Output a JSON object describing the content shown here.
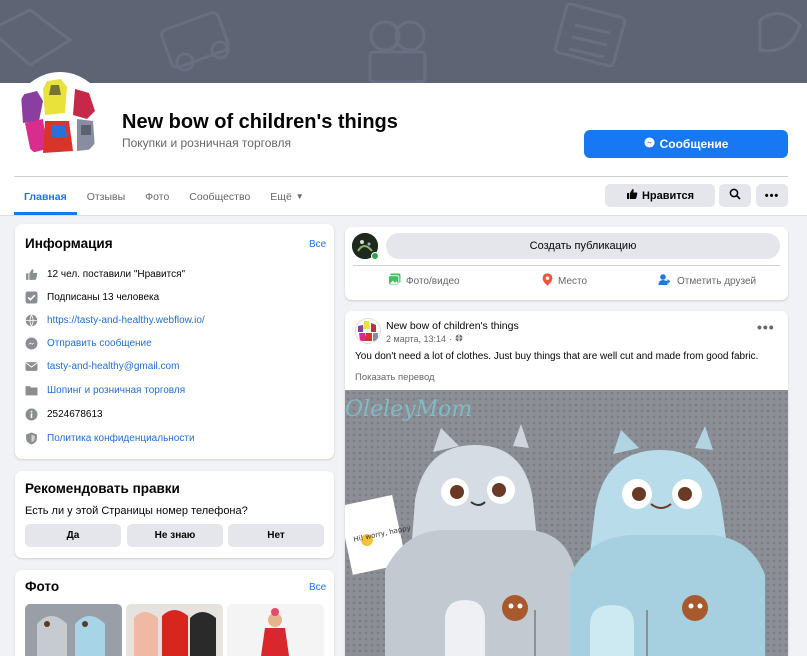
{
  "colors": {
    "accent": "#1877f2",
    "cover": "#5e6474",
    "button_grey": "#e4e6eb",
    "online": "#31a24c"
  },
  "page": {
    "title": "New bow of children's things",
    "category": "Покупки и розничная торговля",
    "message_button": "Сообщение",
    "like_button": "Нравится"
  },
  "tabs": [
    {
      "label": "Главная",
      "active": true
    },
    {
      "label": "Отзывы"
    },
    {
      "label": "Фото"
    },
    {
      "label": "Сообщество"
    },
    {
      "label": "Ещё"
    }
  ],
  "info": {
    "title": "Информация",
    "see_all": "Все",
    "rows": [
      {
        "icon": "thumbs-up-icon",
        "text": "12 чел. поставили \"Нравится\""
      },
      {
        "icon": "check-square-icon",
        "text": "Подписаны 13 человека"
      },
      {
        "icon": "globe-icon",
        "text": "https://tasty-and-healthy.webflow.io/"
      },
      {
        "icon": "messenger-icon",
        "text": "Отправить сообщение"
      },
      {
        "icon": "envelope-icon",
        "text": "tasty-and-healthy@gmail.com"
      },
      {
        "icon": "folder-icon",
        "text": "Шопинг и розничная торговля"
      },
      {
        "icon": "info-icon",
        "text": "2524678613"
      },
      {
        "icon": "shield-icon",
        "text": "Политика конфиденциальности"
      }
    ]
  },
  "recommend": {
    "title": "Рекомендовать правки",
    "question": "Есть ли у этой Страницы номер телефона?",
    "yes": "Да",
    "unknown": "Не знаю",
    "no": "Нет"
  },
  "photos": {
    "title": "Фото",
    "see_all": "Все"
  },
  "composer": {
    "placeholder": "Создать публикацию",
    "photo_video": "Фото/видео",
    "place": "Место",
    "tag_friends": "Отметить друзей"
  },
  "post": {
    "author": "New bow of children's things",
    "date": "2 марта, 13:14",
    "separator": "·",
    "text": "You don't need a lot of clothes. Just buy things that are well cut and made from good fabric.",
    "translate": "Показать перевод",
    "image_caption": "OleleyMom",
    "image_tag": "Hi! worry, happy"
  }
}
